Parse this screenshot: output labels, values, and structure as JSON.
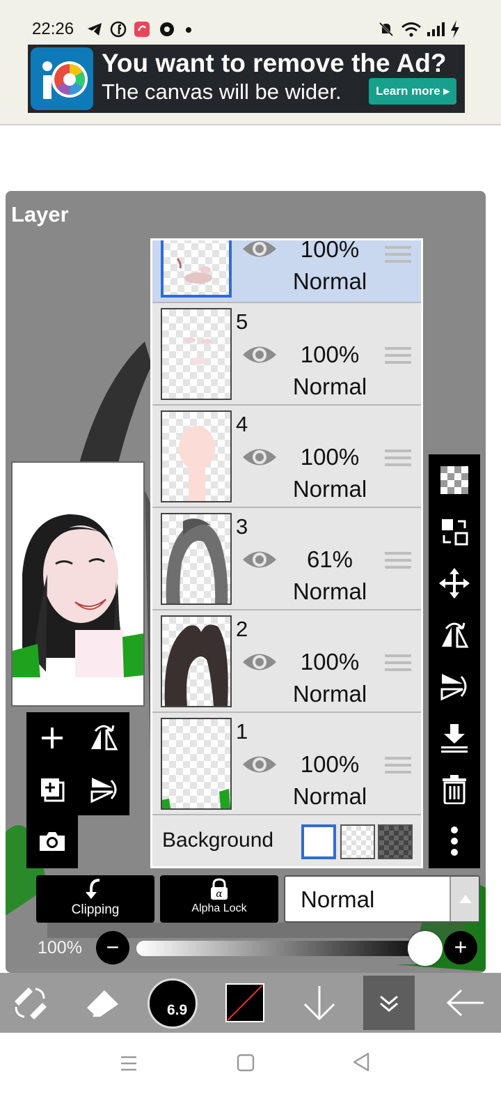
{
  "status_bar": {
    "time": "22:26",
    "icons_left": [
      "telegram-icon",
      "facebook-icon",
      "app-notification-icon",
      "chrome-icon",
      "dot-icon"
    ],
    "icons_right": [
      "mute-icon",
      "wifi-icon",
      "signal-icon",
      "charging-icon"
    ]
  },
  "ad": {
    "title": "You want to remove the Ad?",
    "subtitle": "The canvas will be wider.",
    "button": "Learn more"
  },
  "panel": {
    "title": "Layer"
  },
  "layers": [
    {
      "number": "",
      "opacity": "100%",
      "mode": "Normal",
      "selected": true
    },
    {
      "number": "5",
      "opacity": "100%",
      "mode": "Normal",
      "selected": false
    },
    {
      "number": "4",
      "opacity": "100%",
      "mode": "Normal",
      "selected": false
    },
    {
      "number": "3",
      "opacity": "61%",
      "mode": "Normal",
      "selected": false
    },
    {
      "number": "2",
      "opacity": "100%",
      "mode": "Normal",
      "selected": false
    },
    {
      "number": "1",
      "opacity": "100%",
      "mode": "Normal",
      "selected": false
    }
  ],
  "background": {
    "label": "Background",
    "options": [
      "white",
      "transparent",
      "dark-checker"
    ],
    "selected": "white"
  },
  "controls": {
    "clipping_label": "Clipping",
    "alpha_lock_label": "Alpha Lock",
    "blend_mode": "Normal",
    "opacity_value": "100%",
    "opacity_level": 1.0
  },
  "toolbar": {
    "brush_size": "6.9"
  },
  "colors": {
    "accent": "#2e6dd4",
    "panel": "#888888",
    "ad_button": "#17a08b"
  }
}
